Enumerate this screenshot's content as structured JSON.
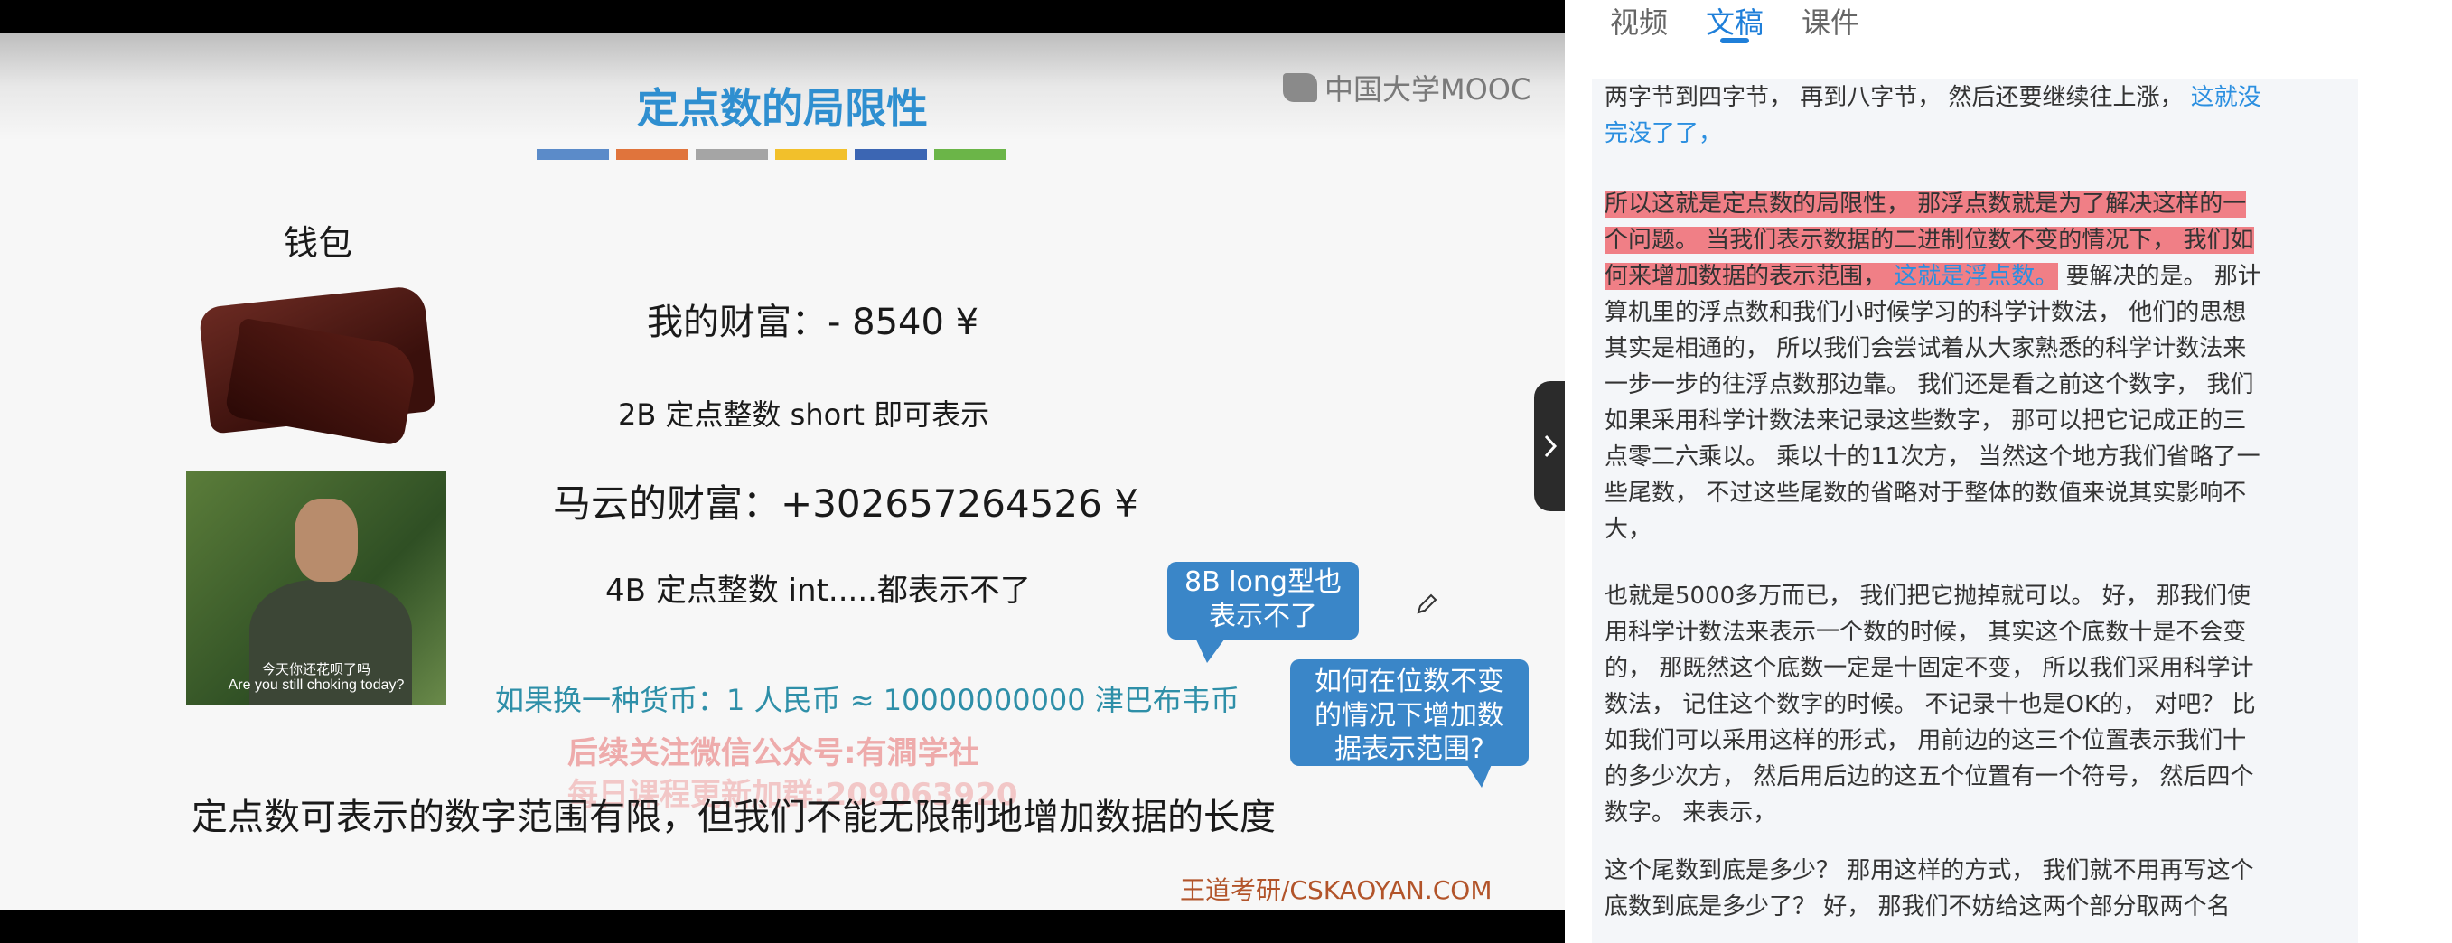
{
  "slide": {
    "title": "定点数的局限性",
    "title_bar_colors": [
      "#5b8bc9",
      "#e0743c",
      "#a5a5a5",
      "#f2c02b",
      "#3c66b3",
      "#6bb548"
    ],
    "logo": "中国大学MOOC",
    "wallet_label": "钱包",
    "my_wealth": "我的财富：- 8540 ¥",
    "my_wealth_note": "2B 定点整数 short 即可表示",
    "photo_caption_cn": "今天你还花呗了吗",
    "photo_caption_en": "Are you still choking today?",
    "ma_wealth": "马云的财富：+302657264526 ¥",
    "ma_wealth_note": "4B 定点整数 int.....都表示不了",
    "bubble_long_line1": "8B long型也",
    "bubble_long_line2": "表示不了",
    "bubble_question_line1": "如何在位数不变",
    "bubble_question_line2": "的情况下增加数",
    "bubble_question_line3": "据表示范围?",
    "currency_line": "如果换一种货币：1 人民币 ≈ 10000000000 津巴布韦币",
    "watermark_line1": "后续关注微信公众号:有澗学社",
    "watermark_line2": "每日课程更新加群:209063920",
    "bottom_statement": "定点数可表示的数字范围有限，但我们不能无限制地增加数据的长度",
    "source_credit": "王道考研/CSKAOYAN.COM",
    "bubble_color": "#3a86c8"
  },
  "panel": {
    "tabs": [
      {
        "label": "视频",
        "active": false
      },
      {
        "label": "文稿",
        "active": true
      },
      {
        "label": "课件",
        "active": false
      }
    ],
    "accent_color": "#1f7fd9",
    "highlight_color": "#f07f86",
    "collapse_icon": "chevron-right-icon",
    "paragraphs": [
      {
        "lines": [
          {
            "parts": [
              {
                "t": " 两字节到四字节， 再到八字节， 然后还要继续往上涨，"
              },
              {
                "t": " 这就没",
                "c": "blue"
              }
            ]
          },
          {
            "parts": [
              {
                "t": "完没了了，",
                "c": "blue"
              }
            ]
          }
        ]
      },
      {
        "lines": [
          {
            "parts": [
              {
                "t": "所以这就是定点数的局限性，",
                "c": "hl"
              },
              {
                "t": "  那浮点数就是为了解决这样的一",
                "c": "hl"
              }
            ]
          },
          {
            "parts": [
              {
                "t": "个问题。 当我们表示数据的二进制位数不变的情况下， 我们如",
                "c": "hl"
              }
            ]
          },
          {
            "parts": [
              {
                "t": "何来增加数据的表示范围，",
                "c": "hl"
              },
              {
                "t": "  这就是浮点数。",
                "c": "hlblue"
              },
              {
                "t": "  要解决的是。 那计"
              }
            ]
          },
          {
            "parts": [
              {
                "t": "算机里的浮点数和我们小时候学习的科学计数法， 他们的思想"
              }
            ]
          },
          {
            "parts": [
              {
                "t": "其实是相通的， 所以我们会尝试着从大家熟悉的科学计数法来"
              }
            ]
          },
          {
            "parts": [
              {
                "t": "一步一步的往浮点数那边靠。 我们还是看之前这个数字， 我们"
              }
            ]
          },
          {
            "parts": [
              {
                "t": "如果采用科学计数法来记录这些数字， 那可以把它记成正的三"
              }
            ]
          },
          {
            "parts": [
              {
                "t": "点零二六乘以。 乘以十的11次方， 当然这个地方我们省略了一"
              }
            ]
          },
          {
            "parts": [
              {
                "t": "些尾数， 不过这些尾数的省略对于整体的数值来说其实影响不"
              }
            ]
          },
          {
            "parts": [
              {
                "t": "大，"
              }
            ]
          }
        ]
      },
      {
        "lines": [
          {
            "parts": [
              {
                "t": "也就是5000多万而已， 我们把它抛掉就可以。 好， 那我们使"
              }
            ]
          },
          {
            "parts": [
              {
                "t": "用科学计数法来表示一个数的时候， 其实这个底数十是不会变"
              }
            ]
          },
          {
            "parts": [
              {
                "t": "的， 那既然这个底数一定是十固定不变， 所以我们采用科学计"
              }
            ]
          },
          {
            "parts": [
              {
                "t": "数法， 记住这个数字的时候。 不记录十也是OK的， 对吧？ 比"
              }
            ]
          },
          {
            "parts": [
              {
                "t": "如我们可以采用这样的形式， 用前边的这三个位置表示我们十"
              }
            ]
          },
          {
            "parts": [
              {
                "t": "的多少次方， 然后用后边的这五个位置有一个符号， 然后四个"
              }
            ]
          },
          {
            "parts": [
              {
                "t": "数字。 来表示，"
              }
            ]
          }
        ]
      },
      {
        "lines": [
          {
            "parts": [
              {
                "t": "这个尾数到底是多少？ 那用这样的方式， 我们就不用再写这个"
              }
            ]
          },
          {
            "parts": [
              {
                "t": "底数到底是多少了？ 好， 那我们不妨给这两个部分取两个名"
              }
            ]
          }
        ]
      }
    ]
  }
}
